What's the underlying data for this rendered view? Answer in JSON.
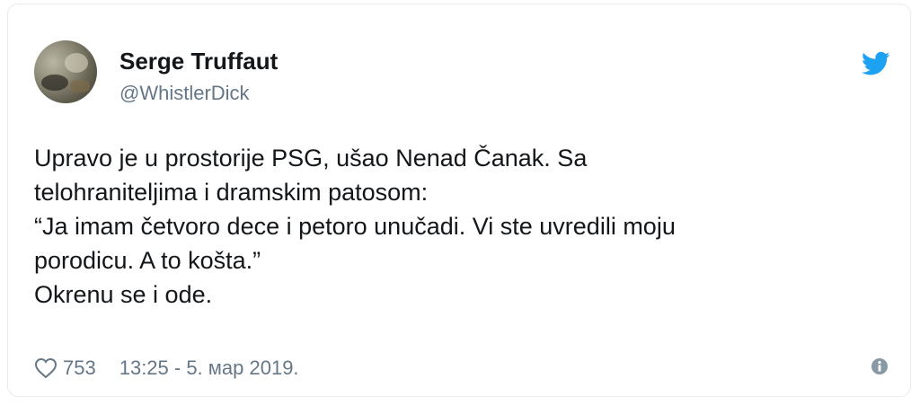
{
  "tweet": {
    "author": {
      "display_name": "Serge Truffaut",
      "handle": "@WhistlerDick"
    },
    "text_lines": [
      "Upravo je u prostorije PSG, ušao Nenad Čanak. Sa",
      "telohraniteljima i dramskim patosom:",
      "“Ja imam četvoro dece i petoro unučadi. Vi ste uvredili moju",
      "porodicu. A to košta.”",
      "Okrenu se i ode."
    ],
    "likes": "753",
    "timestamp": "13:25 - 5. мар 2019."
  },
  "icons": {
    "brand": "twitter-bird-icon",
    "like": "heart-icon",
    "info": "info-icon"
  },
  "colors": {
    "twitter_blue": "#1da1f2",
    "text_primary": "#14171a",
    "text_secondary": "#657786",
    "border": "#e6ecf0"
  }
}
